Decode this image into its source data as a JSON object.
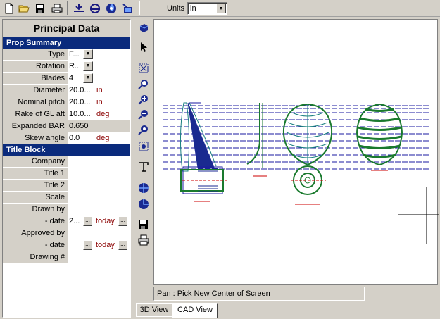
{
  "toolbar": {
    "icons": [
      "new-file-icon",
      "open-folder-icon",
      "save-icon",
      "print-icon",
      "offsets-icon",
      "section-icon",
      "propeller-icon",
      "export-icon"
    ],
    "units_label": "Units",
    "units_value": "in"
  },
  "panel": {
    "title": "Principal Data",
    "prop_summary": {
      "header": "Prop Summary",
      "type_label": "Type",
      "type_value": "F...",
      "rotation_label": "Rotation",
      "rotation_value": "R...",
      "blades_label": "Blades",
      "blades_value": "4",
      "diameter_label": "Diameter",
      "diameter_value": "20.0...",
      "diameter_unit": "in",
      "pitch_label": "Nominal pitch",
      "pitch_value": "20.0...",
      "pitch_unit": "in",
      "rake_label": "Rake of GL aft",
      "rake_value": "10.0...",
      "rake_unit": "deg",
      "bar_label": "Expanded BAR",
      "bar_value": "0.650",
      "skew_label": "Skew angle",
      "skew_value": "0.0",
      "skew_unit": "deg"
    },
    "title_block": {
      "header": "Title Block",
      "company_label": "Company",
      "title1_label": "Title 1",
      "title2_label": "Title 2",
      "scale_label": "Scale",
      "drawn_by_label": "Drawn by",
      "date1_label": "- date",
      "date1_value": "2...",
      "date1_today": "today",
      "approved_by_label": "Approved by",
      "date2_label": "- date",
      "date2_value": "",
      "date2_today": "today",
      "drawing_label": "Drawing #"
    }
  },
  "status_text": "Pan : Pick New Center of Screen",
  "tabs": [
    "3D View",
    "CAD View"
  ],
  "active_tab": "CAD View",
  "colors": {
    "section_header": "#0a2a7c",
    "unit_text": "#8b0000",
    "drawing_green": "#1a7a2e",
    "drawing_blue": "#1a1aa0",
    "drawing_red": "#cc0000"
  }
}
